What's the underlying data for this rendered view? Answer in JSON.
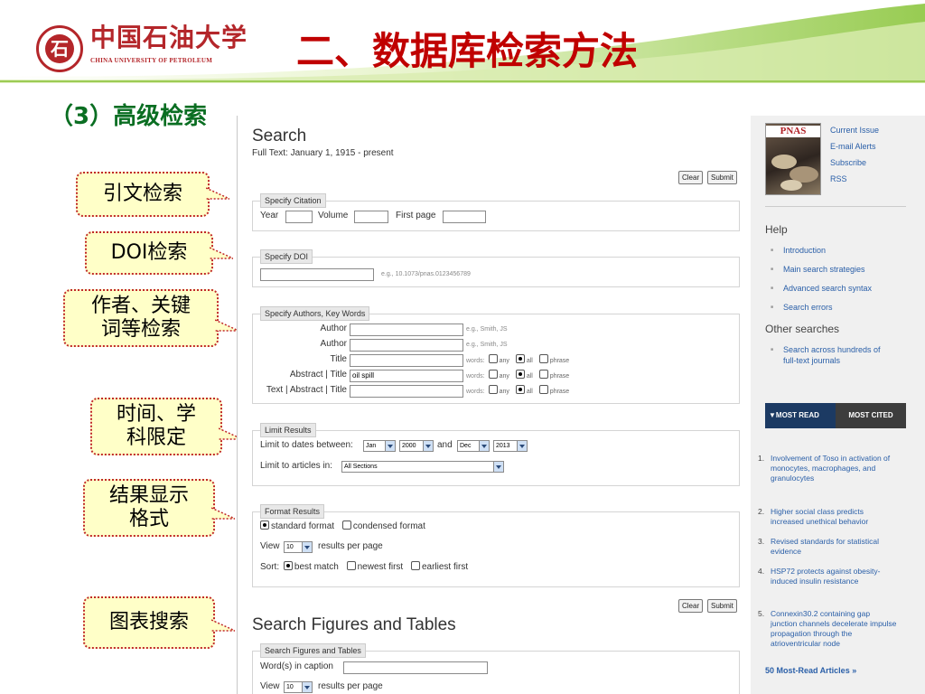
{
  "slide": {
    "logo_cn": "中国石油大学",
    "logo_en": "CHINA UNIVERSITY OF PETROLEUM",
    "title": "二、数据库检索方法",
    "section_title": "（3）高级检索"
  },
  "callouts": [
    "引文检索",
    "DOI检索",
    "作者、关键词等检索",
    "时间、学科限定",
    "结果显示格式",
    "图表搜索"
  ],
  "search": {
    "title": "Search",
    "subtitle": "Full Text: January 1, 1915 - present",
    "clear_label": "Clear",
    "submit_label": "Submit",
    "citation": {
      "legend": "Specify Citation",
      "year_label": "Year",
      "volume_label": "Volume",
      "first_page_label": "First page"
    },
    "doi": {
      "legend": "Specify DOI",
      "hint": "e.g., 10.1073/pnas.0123456789"
    },
    "authors": {
      "legend": "Specify Authors, Key Words",
      "author_label": "Author",
      "author_hint": "e.g., Smith, JS",
      "title_label": "Title",
      "abstract_title_label": "Abstract | Title",
      "abstract_title_value": "oil spill",
      "text_abstract_title_label": "Text | Abstract | Title",
      "words_label": "words:",
      "any_label": "any",
      "all_label": "all",
      "phrase_label": "phrase"
    },
    "limit": {
      "legend": "Limit Results",
      "dates_label": "Limit to dates between:",
      "from_month": "Jan",
      "from_year": "2000",
      "and_label": "and",
      "to_month": "Dec",
      "to_year": "2013",
      "articles_label": "Limit to articles in:",
      "section_value": "All Sections"
    },
    "format": {
      "legend": "Format Results",
      "standard_label": "standard format",
      "condensed_label": "condensed format",
      "view_label": "View",
      "view_value": "10",
      "per_page_label": "results per page",
      "sort_label": "Sort:",
      "best_label": "best match",
      "newest_label": "newest first",
      "earliest_label": "earliest first"
    },
    "figures": {
      "title": "Search Figures and Tables",
      "legend": "Search Figures and Tables",
      "caption_label": "Word(s) in caption",
      "view_label": "View",
      "view_value": "10",
      "per_page_label": "results per page"
    }
  },
  "sidebar": {
    "journal_logo": "PNAS",
    "links": [
      "Current Issue",
      "E-mail Alerts",
      "Subscribe",
      "RSS"
    ],
    "help_title": "Help",
    "help_items": [
      "Introduction",
      "Main search strategies",
      "Advanced search syntax",
      "Search errors"
    ],
    "other_title": "Other searches",
    "other_items": [
      "Search across hundreds of full-text journals"
    ],
    "tab_most_read": "▼MOST READ",
    "tab_most_cited": "MOST CITED",
    "most_read": [
      "Involvement of Toso in activation of monocytes, macrophages, and granulocytes",
      "Higher social class predicts increased unethical behavior",
      "Revised standards for statistical evidence",
      "HSP72 protects against obesity-induced insulin resistance",
      "Connexin30.2 containing gap junction channels decelerate impulse propagation through the atrioventricular node"
    ],
    "more_link": "50 Most-Read Articles »"
  },
  "colors": {
    "title_red": "#c00000",
    "section_green": "#0a6e22",
    "callout_fill": "#ffffc8",
    "callout_border": "#c0282a",
    "link_blue": "#2a5fa8"
  }
}
